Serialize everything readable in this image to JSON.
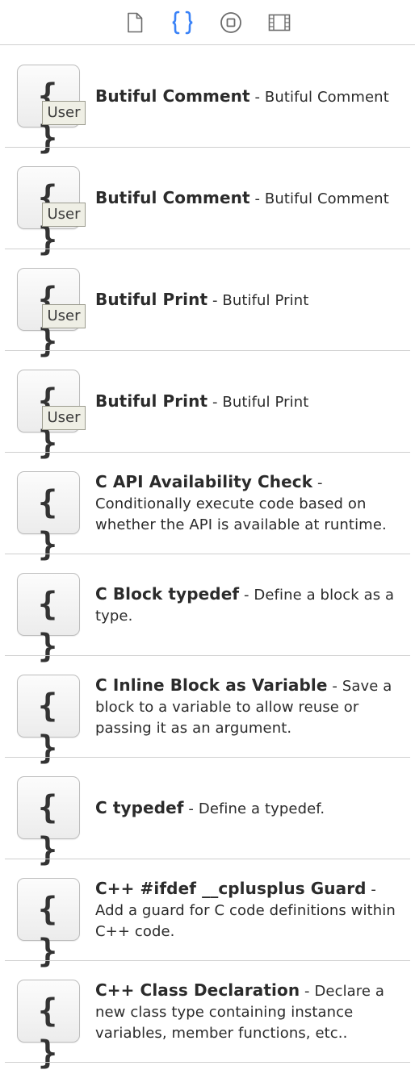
{
  "toolbar": {
    "tabs": [
      {
        "icon": "file-icon",
        "selected": false
      },
      {
        "icon": "braces-icon",
        "selected": true
      },
      {
        "icon": "object-icon",
        "selected": false
      },
      {
        "icon": "media-icon",
        "selected": false
      }
    ],
    "accent_color": "#3a82f7",
    "icon_color": "#6b6b6b"
  },
  "tile_glyph": "{ }",
  "badge_label": "User",
  "separator": " - ",
  "snippets": [
    {
      "title": "Butiful Comment",
      "description": "Butiful Comment",
      "user": true
    },
    {
      "title": "Butiful Comment",
      "description": "Butiful Comment",
      "user": true
    },
    {
      "title": "Butiful Print",
      "description": "Butiful Print",
      "user": true
    },
    {
      "title": "Butiful Print",
      "description": "Butiful Print",
      "user": true
    },
    {
      "title": "C API Availability Check",
      "description": "Conditionally execute code based on whether the API is available at runtime.",
      "user": false
    },
    {
      "title": "C Block typedef",
      "description": "Define a block as a type.",
      "user": false
    },
    {
      "title": "C Inline Block as Variable",
      "description": "Save a block to a variable to allow reuse or passing it as an argument.",
      "user": false
    },
    {
      "title": "C typedef",
      "description": "Define a typedef.",
      "user": false
    },
    {
      "title": "C++ #ifdef __cplusplus Guard",
      "description": "Add a guard for C code definitions within C++ code.",
      "user": false
    },
    {
      "title": "C++ Class Declaration",
      "description": "Declare a new class type containing instance variables, member functions, etc..",
      "user": false
    }
  ]
}
